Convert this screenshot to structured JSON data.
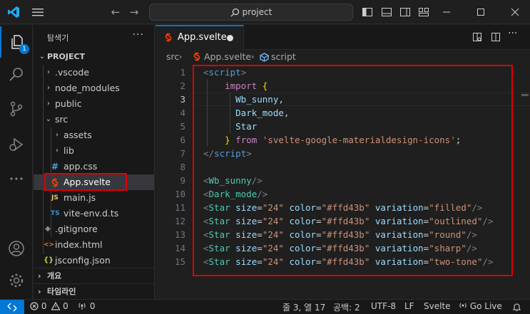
{
  "titlebar": {
    "search_placeholder": "project"
  },
  "activity": {
    "explorer_badge": "1"
  },
  "sidebar": {
    "title": "탐색기",
    "more": "···",
    "project": "PROJECT",
    "items": [
      {
        "label": ".vscode",
        "type": "folder"
      },
      {
        "label": "node_modules",
        "type": "folder"
      },
      {
        "label": "public",
        "type": "folder"
      },
      {
        "label": "src",
        "type": "folder-open"
      },
      {
        "label": "assets",
        "type": "folder"
      },
      {
        "label": "lib",
        "type": "folder"
      },
      {
        "label": "app.css",
        "type": "css",
        "icon": "#"
      },
      {
        "label": "App.svelte",
        "type": "svelte"
      },
      {
        "label": "main.js",
        "type": "js",
        "icon": "JS"
      },
      {
        "label": "vite-env.d.ts",
        "type": "ts",
        "icon": "TS"
      },
      {
        "label": ".gitignore",
        "type": "git"
      },
      {
        "label": "index.html",
        "type": "html",
        "icon": "<>"
      },
      {
        "label": "jsconfig.json",
        "type": "json",
        "icon": "{}"
      }
    ],
    "outline": "개요",
    "timeline": "타임라인"
  },
  "editor": {
    "tab_label": "App.svelte",
    "breadcrumb": {
      "folder": "src",
      "file": "App.svelte",
      "symbol": "script"
    },
    "current_line": 3,
    "line_numbers": [
      "1",
      "2",
      "3",
      "4",
      "5",
      "6",
      "7",
      "8",
      "9",
      "10",
      "11",
      "12",
      "13",
      "14",
      "15"
    ]
  },
  "status": {
    "errors": "0",
    "warnings": "0",
    "ports": "0",
    "position": "줄 3, 열 17",
    "spaces": "공백: 2",
    "encoding": "UTF-8",
    "eol": "LF",
    "language": "Svelte",
    "golive": "Go Live"
  },
  "colors": {
    "accent": "#0078d4",
    "highlight": "#e00000",
    "svelte": "#ff3e00"
  }
}
